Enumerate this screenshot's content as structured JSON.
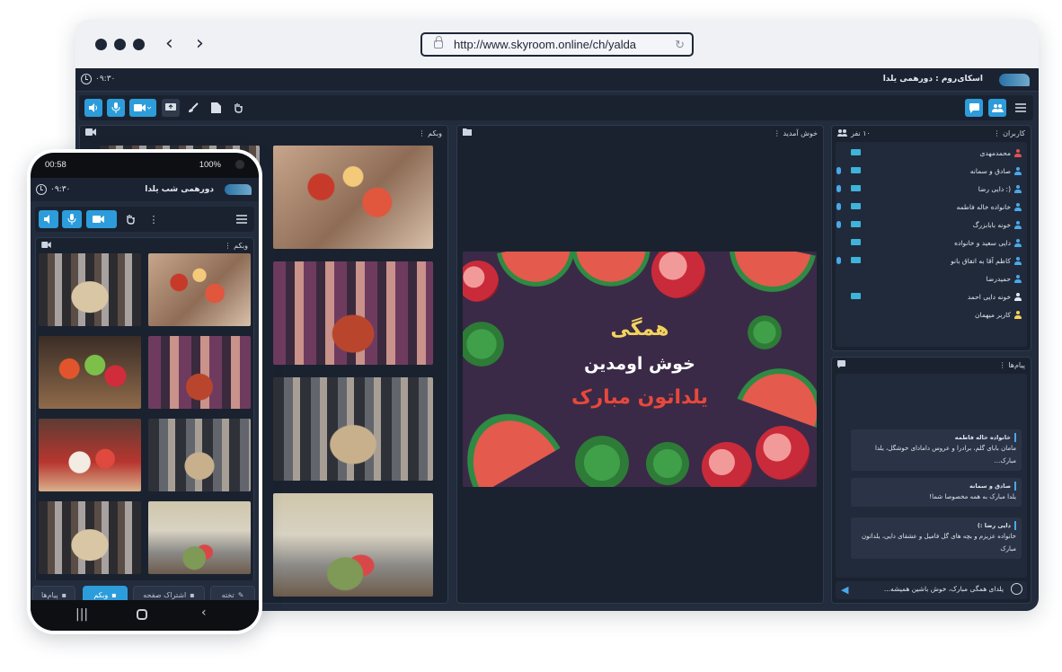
{
  "browser": {
    "url": "http://www.skyroom.online/ch/yalda",
    "back_glyph": "‹",
    "forward_glyph": "›"
  },
  "app": {
    "time": "۰۹:۳۰",
    "room_title": "اسکای‌روم  :  دورهمی یلدا",
    "panels": {
      "webcam": "وبکم",
      "welcome": "خوش آمدید",
      "users": "کاربران",
      "users_count": "۱۰ نفر",
      "messages": "پیام‌ها"
    },
    "slide": {
      "line1": "همگی",
      "line2": "خوش اومدین",
      "line3": "یلداتون مبارک",
      "colors": {
        "line1": "#f4d35e",
        "line2": "#ffffff",
        "line3": "#e8483b"
      }
    },
    "users": [
      {
        "name": "محمدمهدی",
        "mic": false,
        "cam": true,
        "color": "#e05252"
      },
      {
        "name": "صادق و سمانه",
        "mic": true,
        "cam": true,
        "color": "#4aa8e8"
      },
      {
        "name": "دایی رضا :)",
        "mic": true,
        "cam": true,
        "color": "#4aa8e8"
      },
      {
        "name": "خانواده خاله فاطمه",
        "mic": true,
        "cam": true,
        "color": "#4aa8e8"
      },
      {
        "name": "خونه بابابزرگ",
        "mic": true,
        "cam": true,
        "color": "#4aa8e8"
      },
      {
        "name": "دایی سعید و خانواده",
        "mic": false,
        "cam": true,
        "color": "#4aa8e8"
      },
      {
        "name": "کاظم آقا به اتفاق بانو",
        "mic": true,
        "cam": true,
        "color": "#4aa8e8"
      },
      {
        "name": "حمیدرضا",
        "mic": false,
        "cam": false,
        "color": "#4aa8e8"
      },
      {
        "name": "خونه دایی احمد",
        "mic": false,
        "cam": true,
        "color": "#e4e9f2"
      },
      {
        "name": "کاربر میهمان",
        "mic": false,
        "cam": false,
        "color": "#f4d35e"
      }
    ],
    "messages": [
      {
        "sender": "خانواده خاله فاطمه",
        "text": "مامان بابای گلم، برادرا و عروس دامادای خوشگل، یلدا مبارک..."
      },
      {
        "sender": "صادق و سمانه",
        "text": "یلدا مبارک به همه مخصوصا شما!"
      },
      {
        "sender": "دایی رضا :)",
        "text": "خانواده عزیزم و بچه های گل فامیل و عشقای دایی، یلداتون مبارک"
      }
    ],
    "chat_input": "یلدای همگی مبارک، خوش باشین همیشه..."
  },
  "phone": {
    "status_time": "00:58",
    "battery": "100%",
    "app_time": "۰۹:۳۰",
    "room_title": "دورهمی شب یلدا",
    "webcam_label": "وبکم",
    "tabs": {
      "board": "تخته",
      "share": "اشتراک صفحه",
      "webcam": "وبکم",
      "messages": "پیام‌ها"
    }
  }
}
